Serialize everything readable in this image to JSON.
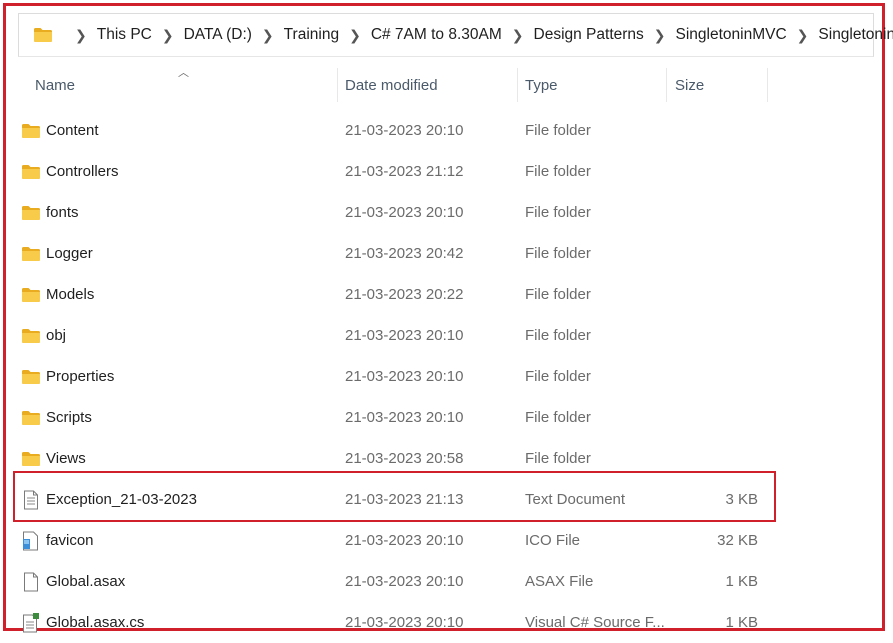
{
  "breadcrumb": [
    "This PC",
    "DATA (D:)",
    "Training",
    "C# 7AM to 8.30AM",
    "Design Patterns",
    "SingletoninMVC",
    "SingletoninMVC"
  ],
  "columns": {
    "name": "Name",
    "date": "Date modified",
    "type": "Type",
    "size": "Size"
  },
  "files": [
    {
      "name": "Content",
      "date": "21-03-2023 20:10",
      "type": "File folder",
      "size": "",
      "icon": "folder-icon"
    },
    {
      "name": "Controllers",
      "date": "21-03-2023 21:12",
      "type": "File folder",
      "size": "",
      "icon": "folder-icon"
    },
    {
      "name": "fonts",
      "date": "21-03-2023 20:10",
      "type": "File folder",
      "size": "",
      "icon": "folder-icon"
    },
    {
      "name": "Logger",
      "date": "21-03-2023 20:42",
      "type": "File folder",
      "size": "",
      "icon": "folder-icon"
    },
    {
      "name": "Models",
      "date": "21-03-2023 20:22",
      "type": "File folder",
      "size": "",
      "icon": "folder-icon"
    },
    {
      "name": "obj",
      "date": "21-03-2023 20:10",
      "type": "File folder",
      "size": "",
      "icon": "folder-icon"
    },
    {
      "name": "Properties",
      "date": "21-03-2023 20:10",
      "type": "File folder",
      "size": "",
      "icon": "folder-icon"
    },
    {
      "name": "Scripts",
      "date": "21-03-2023 20:10",
      "type": "File folder",
      "size": "",
      "icon": "folder-icon"
    },
    {
      "name": "Views",
      "date": "21-03-2023 20:58",
      "type": "File folder",
      "size": "",
      "icon": "folder-icon"
    },
    {
      "name": "Exception_21-03-2023",
      "date": "21-03-2023 21:13",
      "type": "Text Document",
      "size": "3 KB",
      "icon": "text-document-icon"
    },
    {
      "name": "favicon",
      "date": "21-03-2023 20:10",
      "type": "ICO File",
      "size": "32 KB",
      "icon": "ico-file-icon"
    },
    {
      "name": "Global.asax",
      "date": "21-03-2023 20:10",
      "type": "ASAX File",
      "size": "1 KB",
      "icon": "blank-file-icon"
    },
    {
      "name": "Global.asax.cs",
      "date": "21-03-2023 20:10",
      "type": "Visual C# Source F...",
      "size": "1 KB",
      "icon": "csharp-source-icon"
    }
  ],
  "colors": {
    "highlight": "#d0202c",
    "folder": "#f4c23c"
  }
}
